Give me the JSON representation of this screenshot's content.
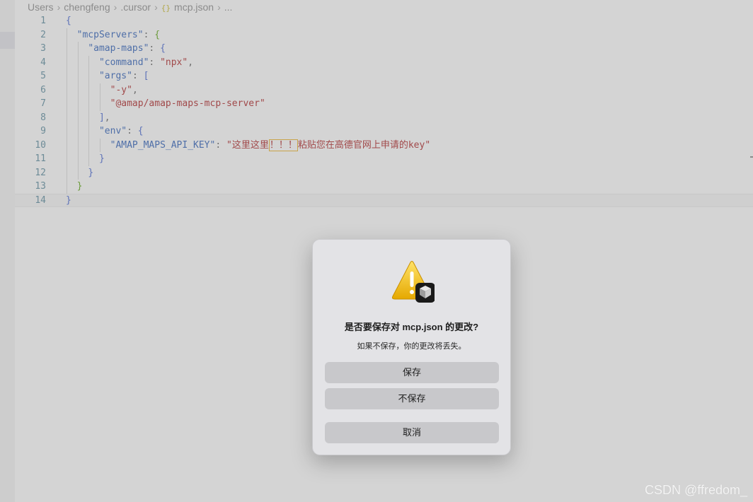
{
  "breadcrumb": {
    "items": [
      "Users",
      "chengfeng",
      ".cursor",
      "mcp.json",
      "..."
    ],
    "file_icon": "{}"
  },
  "code": {
    "lines": [
      {
        "n": "1",
        "t": "{"
      },
      {
        "n": "2",
        "t": "  \"mcpServers\": {"
      },
      {
        "n": "3",
        "t": "    \"amap-maps\": {"
      },
      {
        "n": "4",
        "t": "      \"command\": \"npx\","
      },
      {
        "n": "5",
        "t": "      \"args\": ["
      },
      {
        "n": "6",
        "t": "        \"-y\","
      },
      {
        "n": "7",
        "t": "        \"@amap/amap-maps-mcp-server\""
      },
      {
        "n": "8",
        "t": "      ],"
      },
      {
        "n": "9",
        "t": "      \"env\": {"
      },
      {
        "n": "10",
        "t": "        \"AMAP_MAPS_API_KEY\": \"这里这里！！！粘贴您在高德官网上申请的key\""
      },
      {
        "n": "11",
        "t": "      }"
      },
      {
        "n": "12",
        "t": "    }"
      },
      {
        "n": "13",
        "t": "  }"
      },
      {
        "n": "14",
        "t": "}"
      }
    ]
  },
  "dialog": {
    "icon": "warning-icon",
    "app_badge_icon": "cursor-app-icon",
    "title": "是否要保存对 mcp.json 的更改?",
    "message": "如果不保存，你的更改将丢失。",
    "save_label": "保存",
    "dont_save_label": "不保存",
    "cancel_label": "取消"
  },
  "watermark": "CSDN @ffredom_",
  "colors": {
    "background": "#d4d4d4",
    "dialog_bg": "#e3e3e6",
    "button_bg": "#c8c8cb",
    "string": "#a1494a",
    "key": "#4f6fa8",
    "line_number": "#6d8b97"
  }
}
